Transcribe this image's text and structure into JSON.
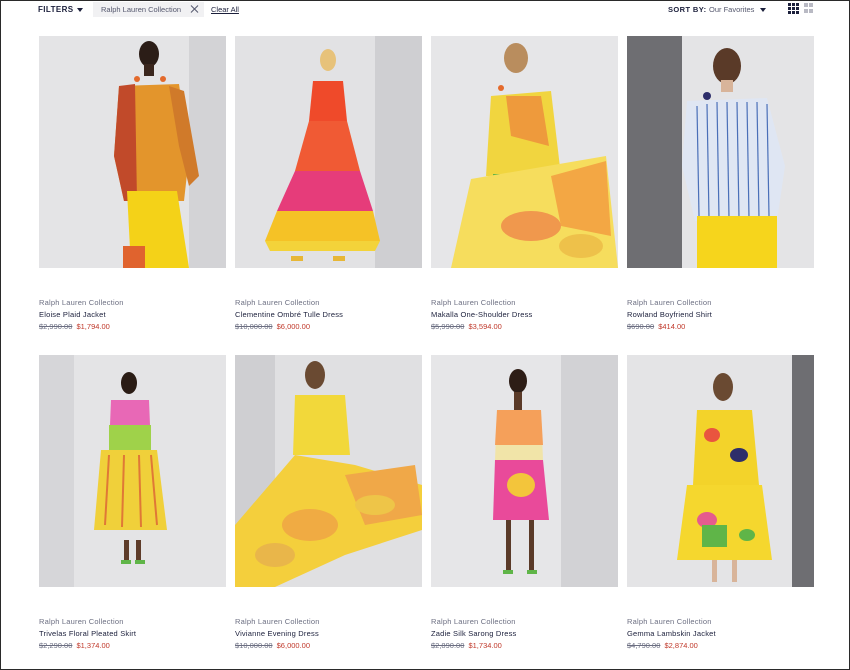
{
  "toolbar": {
    "filters_label": "FILTERS",
    "active_filter": "Ralph Lauren Collection",
    "clear_all": "Clear All",
    "sort_label": "SORT BY:",
    "sort_value": "Our Favorites"
  },
  "products": [
    {
      "brand": "Ralph Lauren Collection",
      "name": "Eloise Plaid Jacket",
      "old_price": "$2,990.00",
      "price": "$1,794.00"
    },
    {
      "brand": "Ralph Lauren Collection",
      "name": "Clementine Ombré Tulle Dress",
      "old_price": "$10,000.00",
      "price": "$6,000.00"
    },
    {
      "brand": "Ralph Lauren Collection",
      "name": "Makalla One-Shoulder Dress",
      "old_price": "$5,990.00",
      "price": "$3,594.00"
    },
    {
      "brand": "Ralph Lauren Collection",
      "name": "Rowland Boyfriend Shirt",
      "old_price": "$690.00",
      "price": "$414.00"
    },
    {
      "brand": "Ralph Lauren Collection",
      "name": "Trivelas Floral Pleated Skirt",
      "old_price": "$2,290.00",
      "price": "$1,374.00"
    },
    {
      "brand": "Ralph Lauren Collection",
      "name": "Vivianne Evening Dress",
      "old_price": "$10,000.00",
      "price": "$6,000.00"
    },
    {
      "brand": "Ralph Lauren Collection",
      "name": "Zadie Silk Sarong Dress",
      "old_price": "$2,890.00",
      "price": "$1,734.00"
    },
    {
      "brand": "Ralph Lauren Collection",
      "name": "Gemma Lambskin Jacket",
      "old_price": "$4,790.00",
      "price": "$2,874.00"
    }
  ],
  "colors": {
    "text_primary": "#1b1f3b",
    "sale_price": "#c0392b",
    "chip_bg": "#f1f1f3"
  },
  "icons": [
    "caret-down-icon",
    "close-icon",
    "grid-4-icon",
    "grid-2-icon"
  ]
}
